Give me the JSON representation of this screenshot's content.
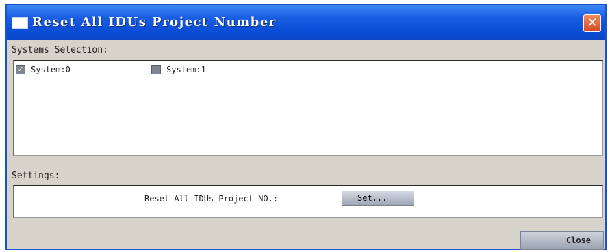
{
  "window": {
    "title": "Reset All IDUs Project Number",
    "close_glyph": "✕"
  },
  "systems_section": {
    "label": "Systems Selection:",
    "items": [
      {
        "label": "System:0",
        "checked": true
      },
      {
        "label": "System:1",
        "checked": false
      }
    ]
  },
  "settings_section": {
    "label": "Settings:",
    "reset_label": "Reset All IDUs Project NO.:",
    "set_button_label": "Set..."
  },
  "footer": {
    "close_button_label": "Close"
  },
  "colors": {
    "title_bar": "#0b4fd8",
    "close_button": "#d9482a",
    "dialog_bg": "#d7d3cb"
  }
}
